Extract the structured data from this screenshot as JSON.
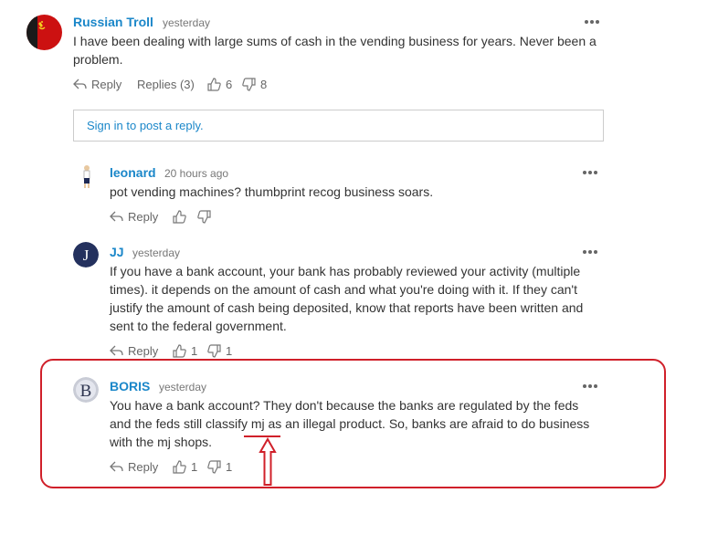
{
  "comments": [
    {
      "author": "Russian Troll",
      "time": "yesterday",
      "text_lines": [
        "I have been dealing with large sums of cash in the vending business for years. Never been a",
        "problem."
      ],
      "reply_label": "Reply",
      "replies_label": "Replies (3)",
      "likes": "6",
      "dislikes": "8",
      "avatar_icon": "soviet-flag-avatar-icon"
    },
    {
      "author": "leonard",
      "time": "20 hours ago",
      "text_lines": [
        "pot vending machines? thumbprint recog business soars."
      ],
      "reply_label": "Reply",
      "avatar_icon": "person-figure-avatar-icon"
    },
    {
      "author": "JJ",
      "time": "yesterday",
      "text_lines": [
        "If you have a bank account, your bank has probably reviewed your activity (multiple",
        "times). it depends on the amount of cash and what you're doing with it. If they can't",
        "justify the amount of cash being deposited, know that reports have been written and",
        "sent to the federal government."
      ],
      "reply_label": "Reply",
      "likes": "1",
      "dislikes": "1",
      "avatar_letter": "J"
    },
    {
      "author": "BORIS",
      "time": "yesterday",
      "text_lines": [
        "You have a bank account? They don't because the banks are regulated by the feds",
        "and the feds still classify mj as an illegal product. So, banks are afraid to do business",
        "with the mj shops."
      ],
      "reply_label": "Reply",
      "likes": "1",
      "dislikes": "1",
      "avatar_letter": "B"
    }
  ],
  "signin_prompt": "Sign in to post a reply.",
  "colors": {
    "link_blue": "#1b87c9",
    "annotation_red": "#d0202a",
    "border_grey": "#cccccc"
  }
}
